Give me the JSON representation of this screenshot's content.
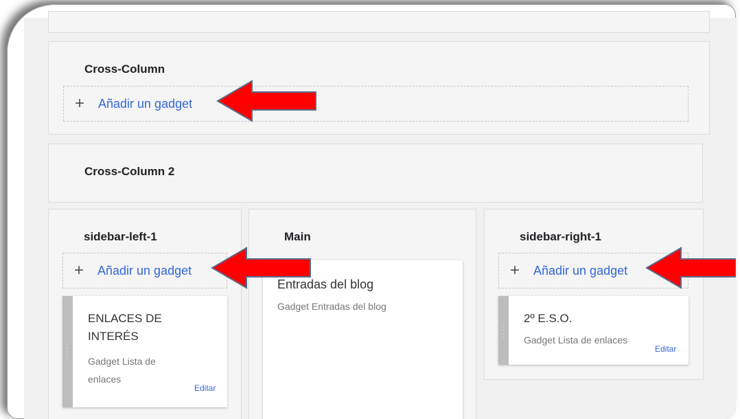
{
  "layout_editor": {
    "sections": {
      "cross_column": {
        "title": "Cross-Column",
        "add_gadget": "Añadir un gadget"
      },
      "cross_column_2": {
        "title": "Cross-Column 2"
      },
      "sidebar_left": {
        "title": "sidebar-left-1",
        "add_gadget": "Añadir un gadget",
        "gadget": {
          "title": "ENLACES DE INTERÉS",
          "subtitle": "Gadget Lista de enlaces",
          "edit": "Editar"
        }
      },
      "main": {
        "title": "Main",
        "gadget": {
          "title": "Entradas del blog",
          "subtitle": "Gadget Entradas del blog"
        }
      },
      "sidebar_right": {
        "title": "sidebar-right-1",
        "add_gadget": "Añadir un gadget",
        "gadget": {
          "title": "2º E.S.O.",
          "subtitle": "Gadget Lista de enlaces",
          "edit": "Editar"
        }
      }
    },
    "plus_icon": "plus-icon",
    "annotation_arrow_color": "#ff0000",
    "link_color": "#3367d6"
  }
}
